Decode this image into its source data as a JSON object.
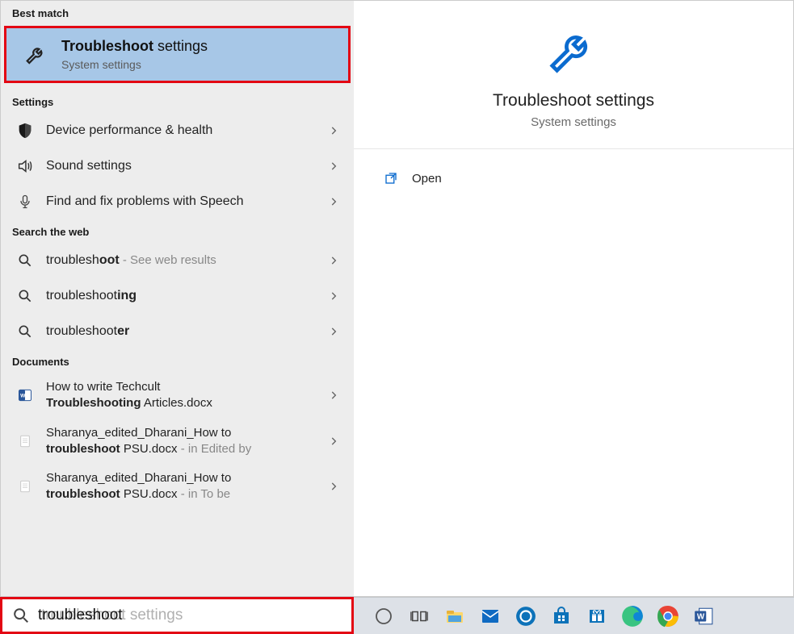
{
  "left": {
    "best_match": {
      "header": "Best match",
      "title_bold": "Troubleshoot",
      "title_rest": " settings",
      "subtitle": "System settings"
    },
    "settings": {
      "header": "Settings",
      "items": [
        {
          "icon": "shield",
          "label": "Device performance & health"
        },
        {
          "icon": "speaker",
          "label": "Sound settings"
        },
        {
          "icon": "mic",
          "label": "Find and fix problems with Speech"
        }
      ]
    },
    "web": {
      "header": "Search the web",
      "items": [
        {
          "prefix": "troublesh",
          "bold": "oot",
          "suffix": " - See web results"
        },
        {
          "prefix": "troubleshoot",
          "bold": "ing",
          "suffix": ""
        },
        {
          "prefix": "troubleshoot",
          "bold": "er",
          "suffix": ""
        }
      ]
    },
    "documents": {
      "header": "Documents",
      "items": [
        {
          "icon": "word",
          "line1_pre": "How to write Techcult ",
          "line1_bold": "",
          "line2_bold": "Troubleshooting",
          "line2_post": " Articles.docx",
          "meta": ""
        },
        {
          "icon": "doc",
          "line1_pre": "Sharanya_edited_Dharani_How to ",
          "line1_bold": "",
          "line2_bold": "troubleshoot",
          "line2_post": " PSU.docx",
          "meta": " - in Edited by"
        },
        {
          "icon": "doc",
          "line1_pre": "Sharanya_edited_Dharani_How to ",
          "line1_bold": "",
          "line2_bold": "troubleshoot",
          "line2_post": " PSU.docx",
          "meta": " - in To be"
        }
      ]
    }
  },
  "right": {
    "title": "Troubleshoot settings",
    "subtitle": "System settings",
    "actions": [
      {
        "label": "Open"
      }
    ]
  },
  "search": {
    "typed": "troubleshoot",
    "ghost_full": "troubleshoot settings"
  },
  "taskbar": [
    {
      "name": "cortana-icon"
    },
    {
      "name": "task-view-icon"
    },
    {
      "name": "file-explorer-icon"
    },
    {
      "name": "mail-icon"
    },
    {
      "name": "dell-icon"
    },
    {
      "name": "store-icon"
    },
    {
      "name": "gift-icon"
    },
    {
      "name": "edge-icon"
    },
    {
      "name": "chrome-icon"
    },
    {
      "name": "word-icon"
    }
  ]
}
